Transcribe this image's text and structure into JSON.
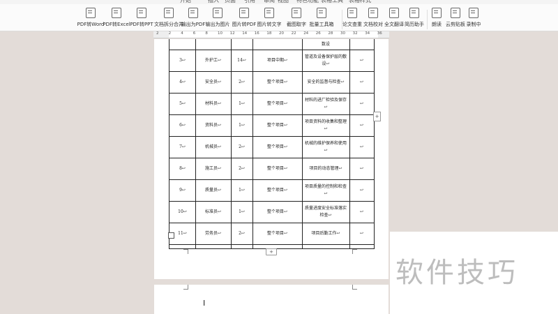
{
  "top_tabs": [
    "开始",
    "插入",
    "页面",
    "引用",
    "审阅",
    "视图",
    "特色功能",
    "表格工具",
    "表格样式"
  ],
  "toolbar": {
    "groups": [
      [
        {
          "label": "PDF转Word",
          "icon": "pdf-to-word-icon"
        },
        {
          "label": "PDF转Excel",
          "icon": "pdf-to-excel-icon"
        },
        {
          "label": "PDF转PPT",
          "icon": "pdf-to-ppt-icon"
        },
        {
          "label": "文档拆分合并",
          "icon": "split-merge-icon"
        },
        {
          "label": "输出为PDF",
          "icon": "export-pdf-icon"
        },
        {
          "label": "输出为图片",
          "icon": "export-image-icon"
        },
        {
          "label": "图片转PDF",
          "icon": "image-to-pdf-icon"
        },
        {
          "label": "图片转文字",
          "icon": "image-to-text-icon"
        },
        {
          "label": "截图取字",
          "icon": "screenshot-ocr-icon"
        },
        {
          "label": "批量工具箱",
          "icon": "batch-toolbox-icon"
        }
      ],
      [
        {
          "label": "论文查重",
          "icon": "plagiarism-check-icon"
        },
        {
          "label": "文档校对",
          "icon": "proofread-icon"
        },
        {
          "label": "全文翻译",
          "icon": "translate-icon"
        },
        {
          "label": "简历助手",
          "icon": "resume-icon"
        }
      ],
      [
        {
          "label": "朗读",
          "icon": "read-aloud-icon"
        },
        {
          "label": "云剪贴板",
          "icon": "cloud-clipboard-icon"
        },
        {
          "label": "录制中",
          "icon": "recording-icon"
        }
      ]
    ]
  },
  "ruler": [
    "2",
    "2",
    "4",
    "6",
    "8",
    "10",
    "12",
    "14",
    "16",
    "18",
    "20",
    "22",
    "24",
    "26",
    "28",
    "30",
    "32",
    "34",
    "36"
  ],
  "table": {
    "top_fragment": "数设",
    "rows": [
      {
        "no": "3↩",
        "role": "外护工↩",
        "count": "14↩",
        "period": "项目中期↩",
        "duty": "管道及设备保护层的敷设↩",
        "note": "↩"
      },
      {
        "no": "4↩",
        "role": "安全员↩",
        "count": "2↩",
        "period": "整个项目↩",
        "duty": "安全的监督与检查↩",
        "note": "↩"
      },
      {
        "no": "5↩",
        "role": "材料员↩",
        "count": "1↩",
        "period": "整个项目↩",
        "duty": "材料的进厂检验及保存↩",
        "note": "↩"
      },
      {
        "no": "6↩",
        "role": "资料员↩",
        "count": "1↩",
        "period": "整个项目↩",
        "duty": "项目资料的收集和整理↩",
        "note": "↩"
      },
      {
        "no": "7↩",
        "role": "机械员↩",
        "count": "2↩",
        "period": "整个项目↩",
        "duty": "机械的维护保养和使用↩",
        "note": "↩"
      },
      {
        "no": "8↩",
        "role": "施工员↩",
        "count": "2↩",
        "period": "整个项目↩",
        "duty": "项目的动态管理↩",
        "note": "↩"
      },
      {
        "no": "9↩",
        "role": "质量员↩",
        "count": "1↩",
        "period": "整个项目↩",
        "duty": "项目质量的控制和检查↩",
        "note": "↩"
      },
      {
        "no": "10↩",
        "role": "标准员↩",
        "count": "1↩",
        "period": "整个项目↩",
        "duty": "质量进度安全标准落实检查↩",
        "note": "↩"
      },
      {
        "no": "11↩",
        "role": "劳务员↩",
        "count": "2↩",
        "period": "整个项目↩",
        "duty": "项目后勤工作↩",
        "note": "↩"
      }
    ]
  },
  "controls": {
    "add_row": "+",
    "side_add": "+"
  },
  "watermark": "软件技巧"
}
